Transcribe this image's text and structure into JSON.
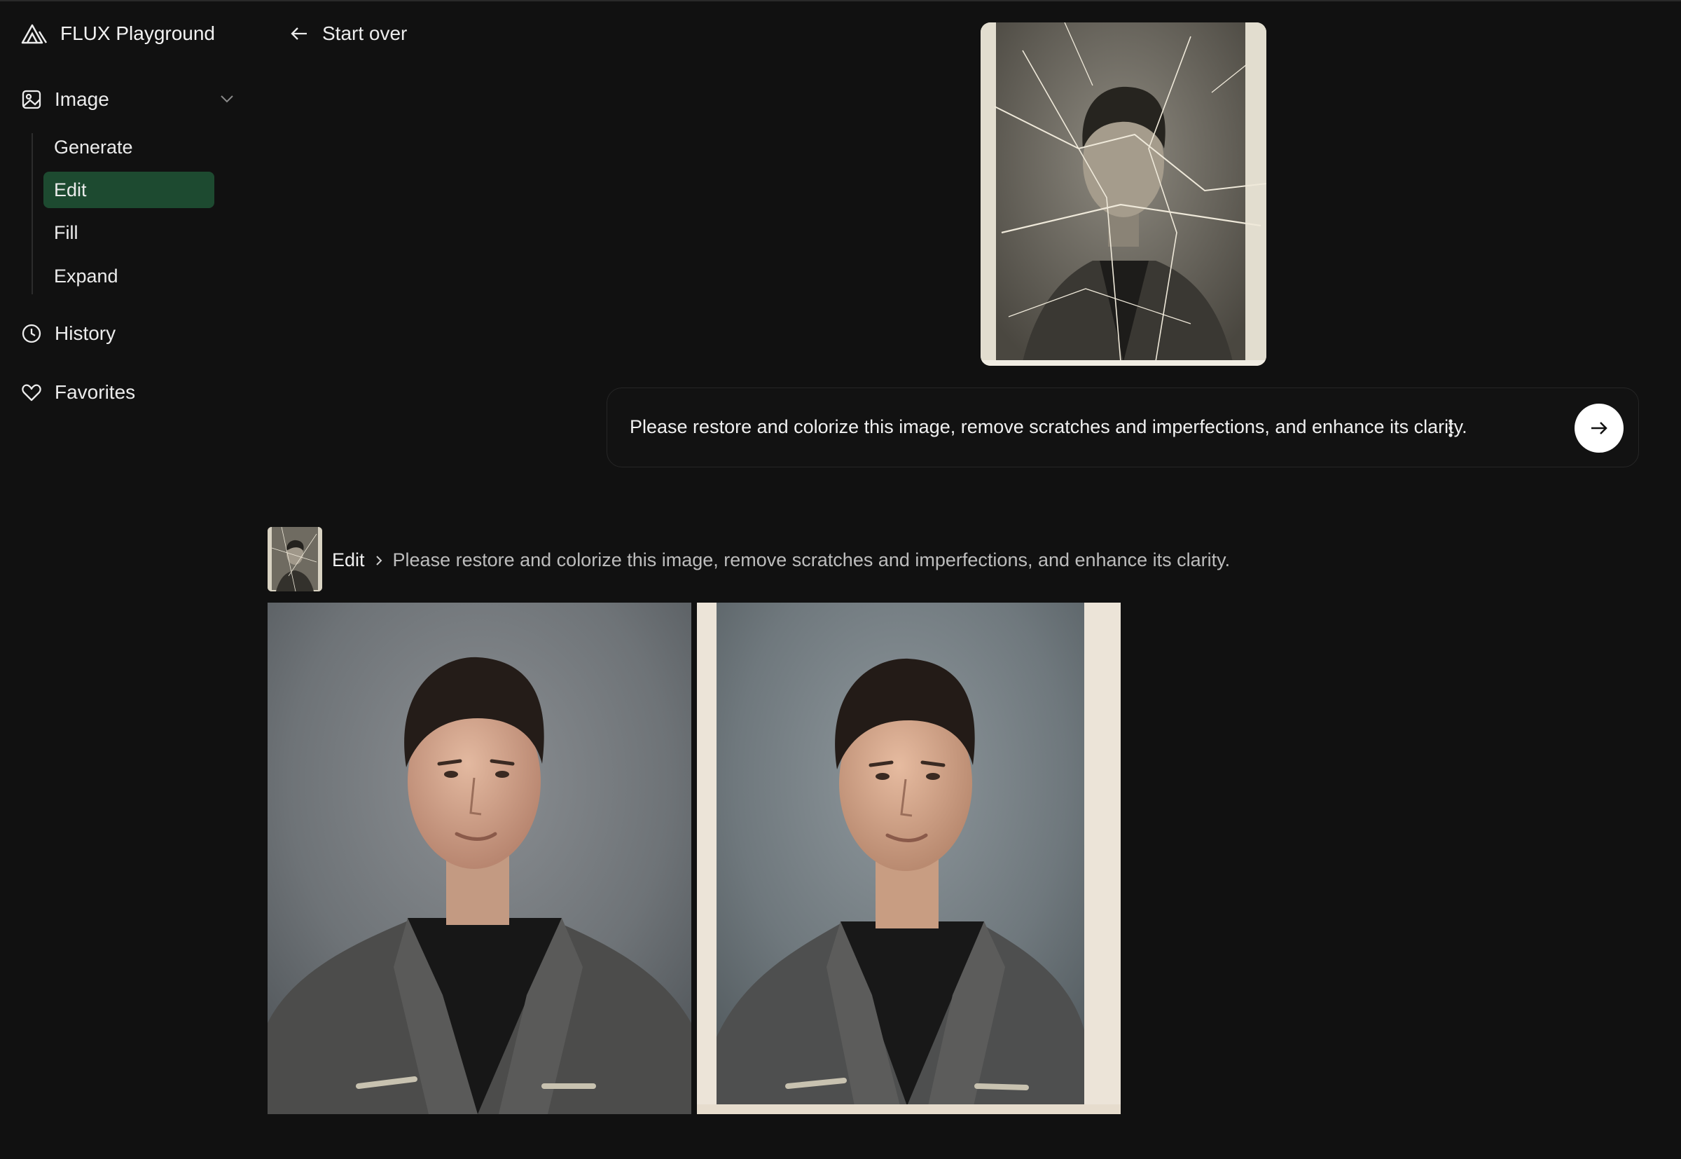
{
  "app": {
    "title": "FLUX Playground",
    "logo_icon": "flux-logo-icon"
  },
  "sidebar": {
    "section": {
      "label": "Image",
      "icon": "image-icon",
      "expanded": true
    },
    "sub_items": [
      {
        "label": "Generate",
        "active": false
      },
      {
        "label": "Edit",
        "active": true
      },
      {
        "label": "Fill",
        "active": false
      },
      {
        "label": "Expand",
        "active": false
      }
    ],
    "history": {
      "label": "History",
      "icon": "clock-icon"
    },
    "favorites": {
      "label": "Favorites",
      "icon": "heart-icon"
    }
  },
  "topbar": {
    "start_over": "Start over"
  },
  "prompt": {
    "value": "Please restore and colorize this image, remove scratches and imperfections, and enhance its clarity.",
    "more_icon": "more-vertical-icon",
    "send_icon": "arrow-right-icon"
  },
  "entry": {
    "mode": "Edit",
    "prompt": "Please restore and colorize this image, remove scratches and imperfections, and enhance its clarity."
  },
  "colors": {
    "background": "#111111",
    "active_item": "#1d4a30",
    "text": "#ececec",
    "muted_text": "#bdbdbd"
  }
}
